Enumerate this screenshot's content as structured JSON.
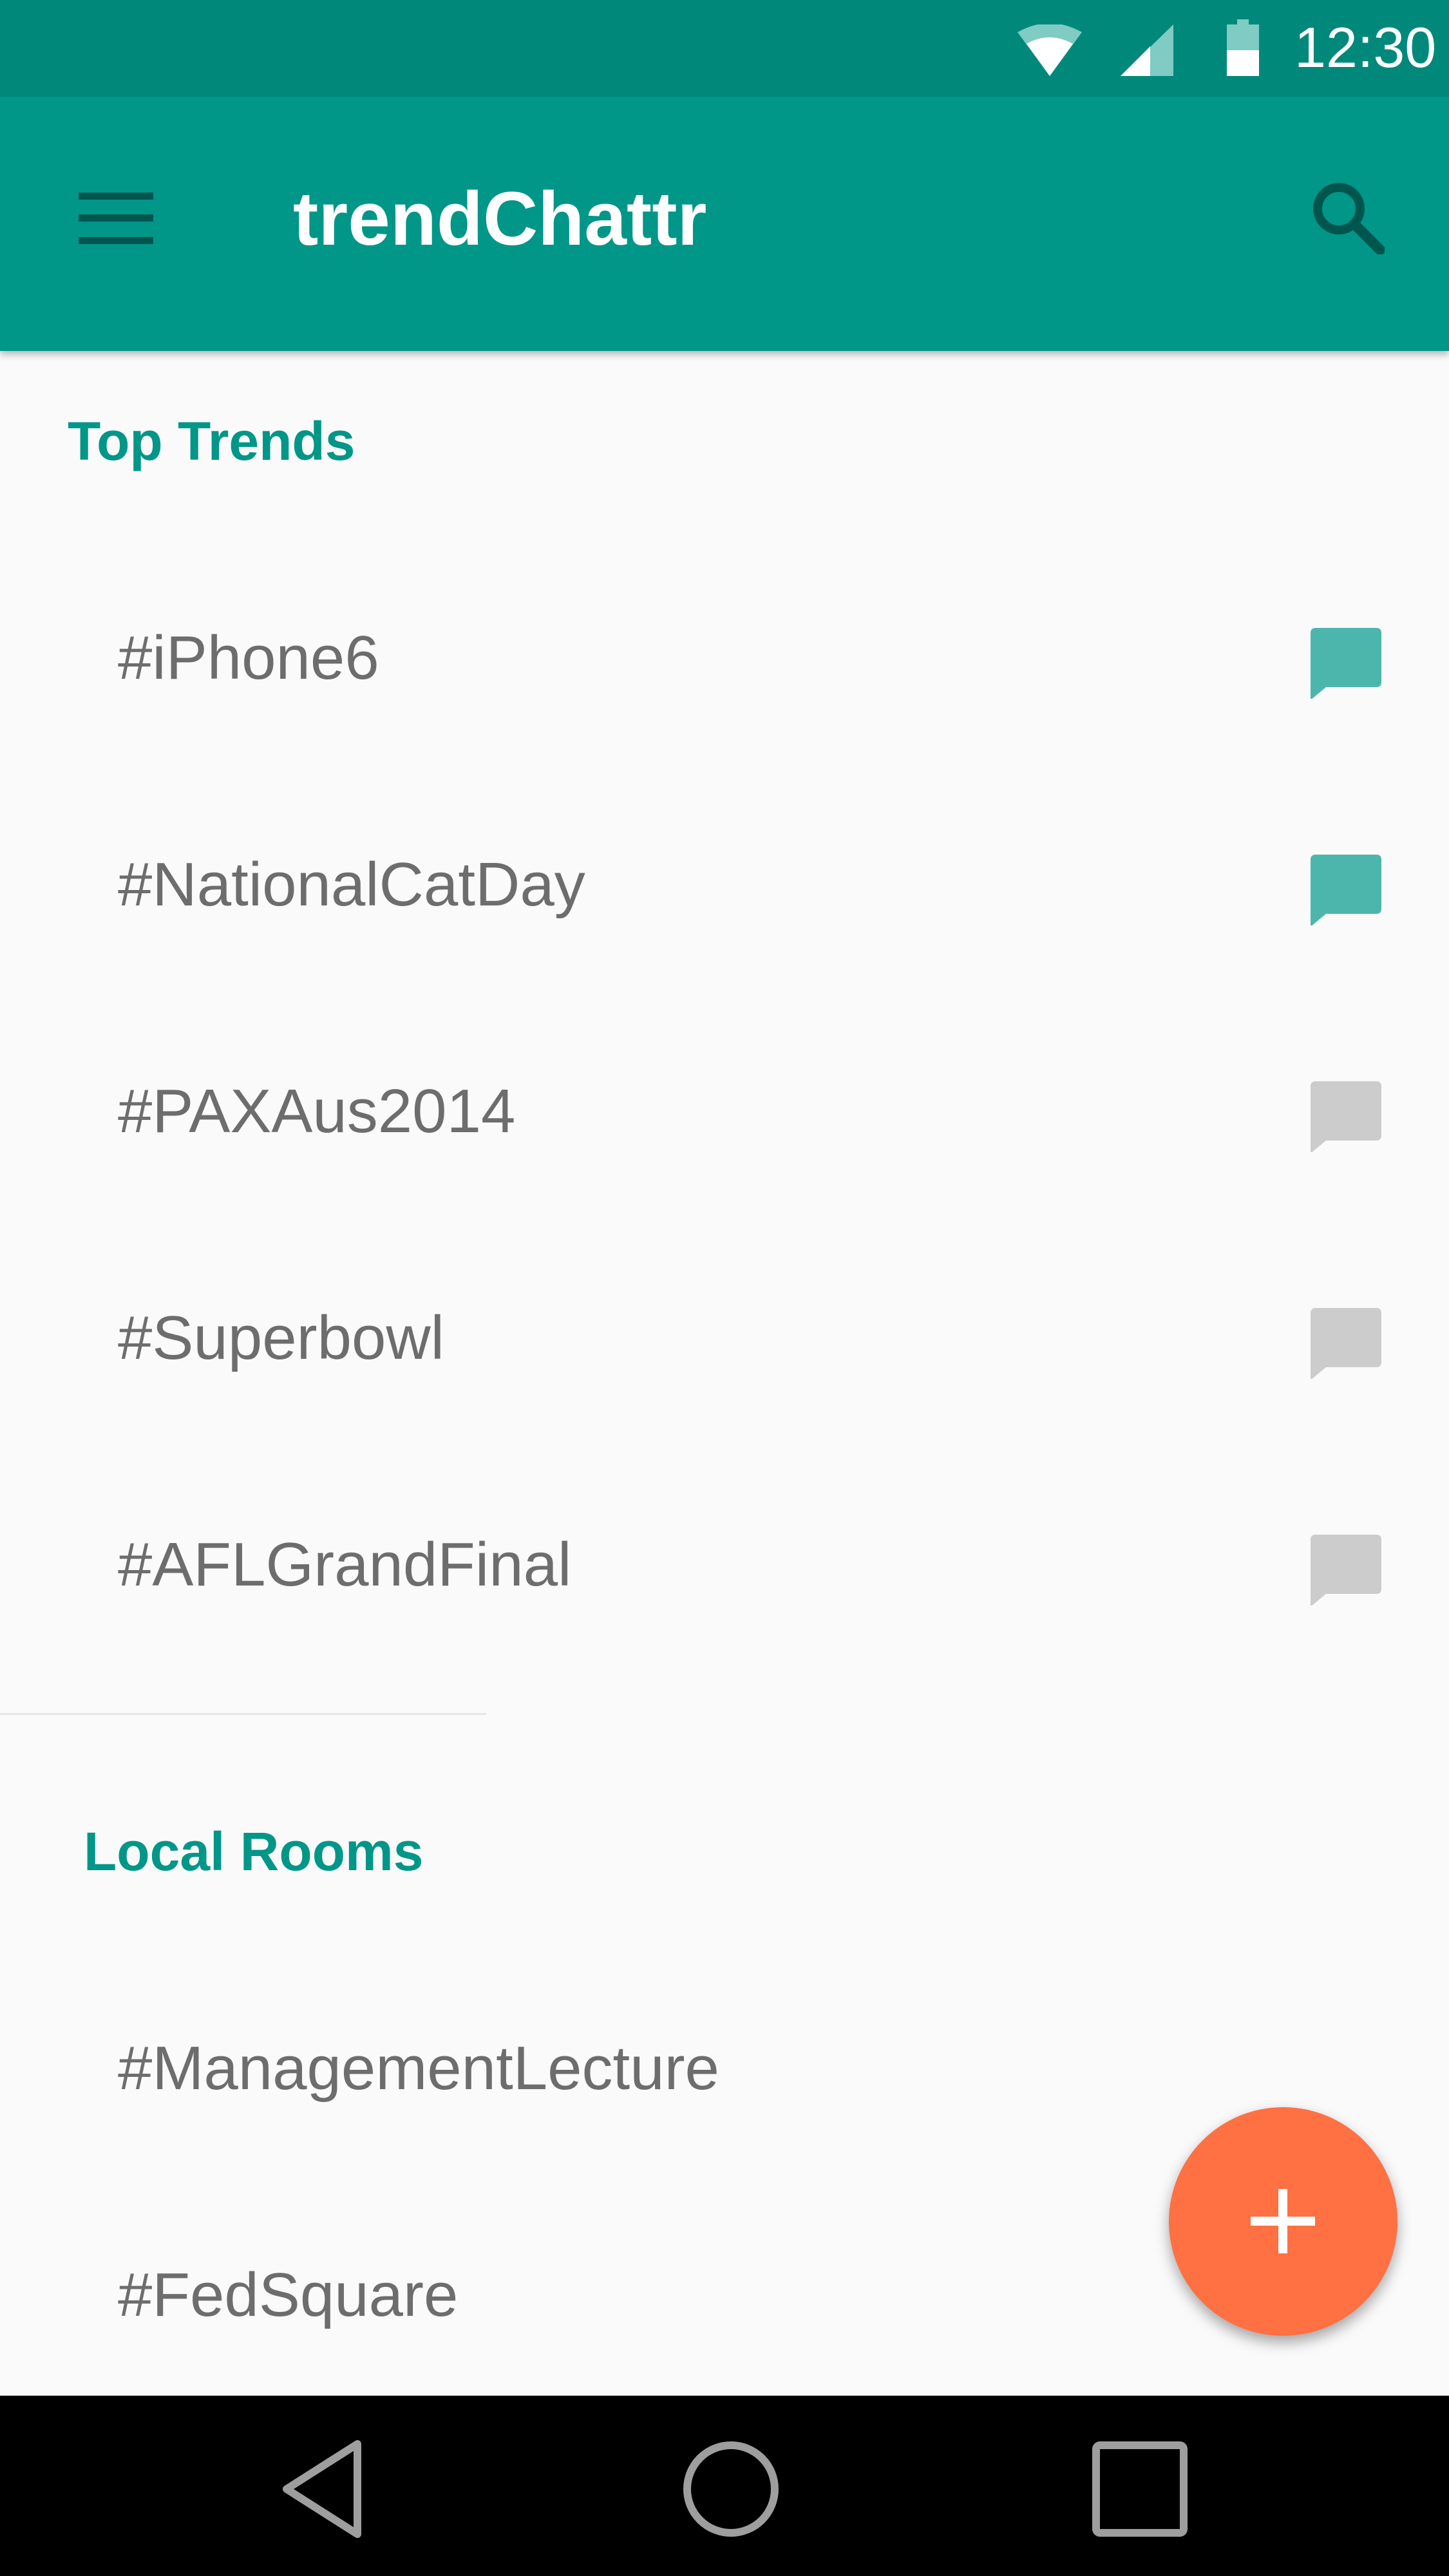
{
  "status_bar": {
    "time": "12:30",
    "icons": [
      "wifi-icon",
      "signal-icon",
      "battery-icon"
    ]
  },
  "app_bar": {
    "title": "trendChattr",
    "menu_icon": "menu-icon",
    "search_icon": "search-icon"
  },
  "sections": {
    "top_trends": {
      "title": "Top Trends",
      "items": [
        {
          "label": "#iPhone6",
          "active": true
        },
        {
          "label": "#NationalCatDay",
          "active": true
        },
        {
          "label": "#PAXAus2014",
          "active": false
        },
        {
          "label": "#Superbowl",
          "active": false
        },
        {
          "label": "#AFLGrandFinal",
          "active": false
        }
      ]
    },
    "local_rooms": {
      "title": "Local Rooms",
      "items": [
        {
          "label": "#ManagementLecture"
        },
        {
          "label": "#FedSquare"
        }
      ]
    }
  },
  "fab": {
    "icon": "plus-icon"
  },
  "nav_bar": {
    "icons": [
      "back-icon",
      "home-icon",
      "recents-icon"
    ]
  },
  "colors": {
    "primary": "#009688",
    "primary_dark": "#00897b",
    "accent": "#ff7043",
    "chat_active": "#4db6ac",
    "chat_inactive": "#cccccc",
    "text": "#6d6d6d"
  }
}
